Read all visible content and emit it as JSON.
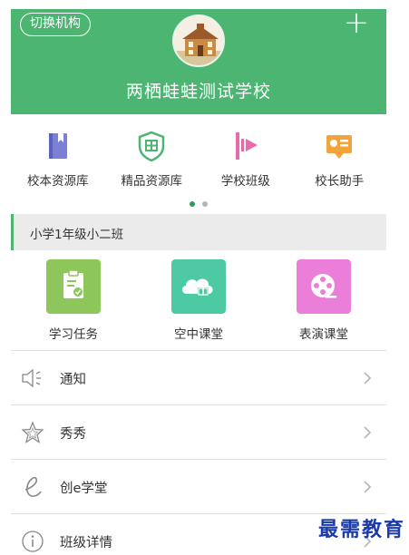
{
  "header": {
    "switch_label": "切换机构",
    "plus_label": "+",
    "school_name": "两栖蛙蛙测试学校",
    "background_color": "#4cb572",
    "logo_icon": "school-building-icon"
  },
  "quick_grid": [
    {
      "label": "校本资源库",
      "icon": "book-icon",
      "color": "#7b7fd6"
    },
    {
      "label": "精品资源库",
      "icon": "shield-icon",
      "color": "#4cb572"
    },
    {
      "label": "学校班级",
      "icon": "play-flag-icon",
      "color": "#e86aa8"
    },
    {
      "label": "校长助手",
      "icon": "assistant-card-icon",
      "color": "#f2a33b"
    }
  ],
  "pager": {
    "active_page": 1,
    "total_pages": 2
  },
  "class_bar": {
    "label": "小学1年级小二班"
  },
  "features": [
    {
      "label": "学习任务",
      "icon": "clipboard-icon",
      "color": "#8dc65a"
    },
    {
      "label": "空中课堂",
      "icon": "cloud-book-icon",
      "color": "#4dcaa3"
    },
    {
      "label": "表演课堂",
      "icon": "film-reel-icon",
      "color": "#ea7ed9"
    }
  ],
  "list": [
    {
      "label": "通知",
      "icon": "speaker-icon"
    },
    {
      "label": "秀秀",
      "icon": "star-icon"
    },
    {
      "label": "创e学堂",
      "icon": "e-letter-icon"
    },
    {
      "label": "班级详情",
      "icon": "info-icon"
    }
  ],
  "watermark": "最需教育"
}
